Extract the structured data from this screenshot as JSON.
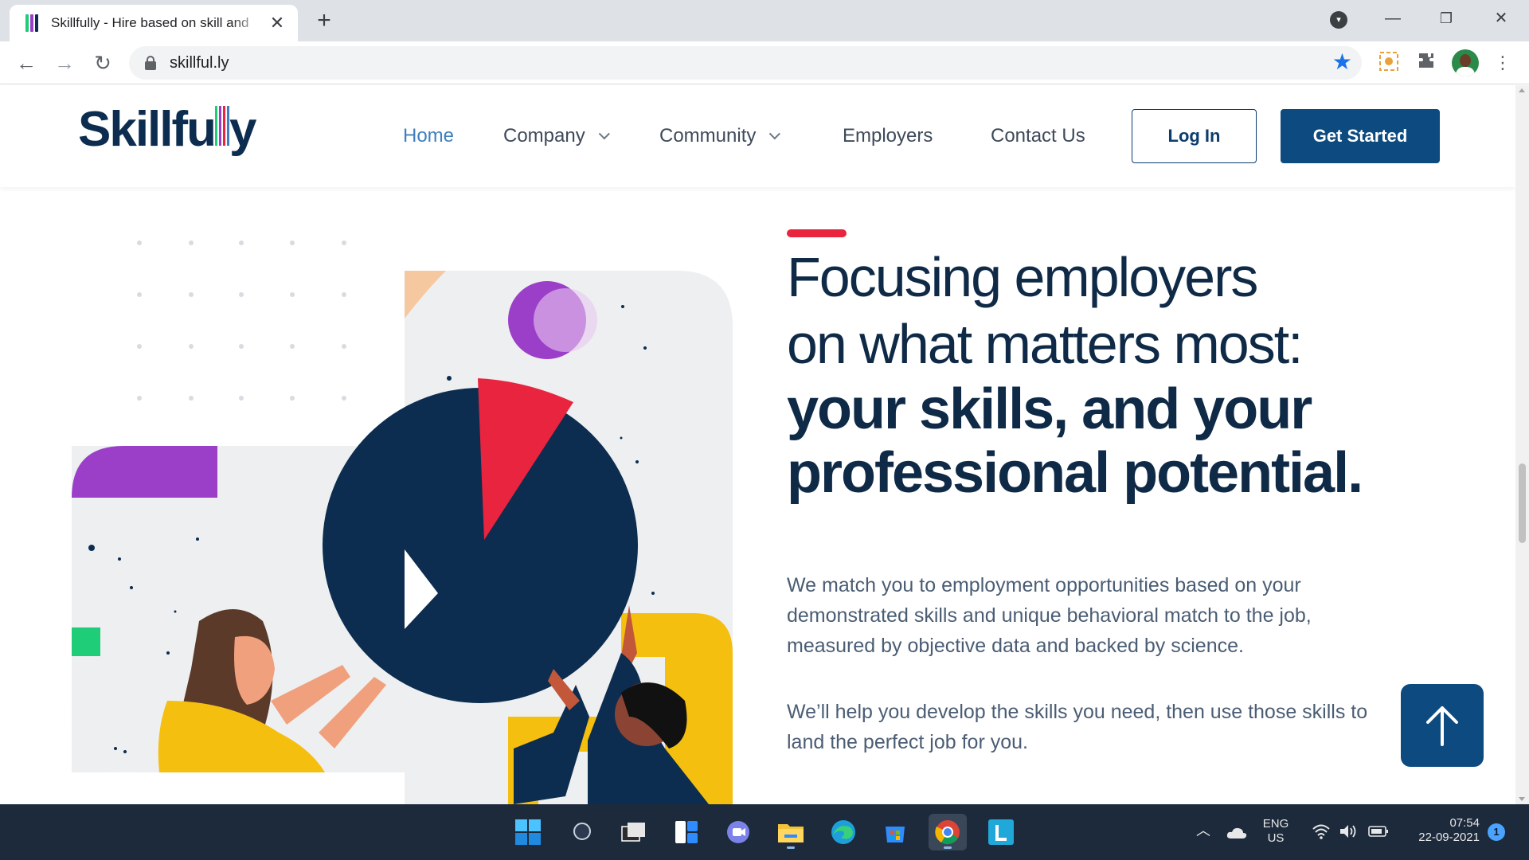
{
  "browser": {
    "tab_title": "Skillfully - Hire based on skill and",
    "url": "skillful.ly",
    "new_tab_label": "+",
    "close_tab_label": "✕"
  },
  "site": {
    "logo_text_a": "Skillfu",
    "logo_text_b": "y",
    "nav": {
      "home": "Home",
      "company": "Company",
      "community": "Community",
      "employers": "Employers",
      "contact": "Contact Us"
    },
    "login_label": "Log In",
    "get_started_label": "Get Started"
  },
  "hero": {
    "headline_line1": "Focusing employers",
    "headline_line2": "on what matters most:",
    "headline_line3": "your skills, and your",
    "headline_line4": "professional potential.",
    "para1": "We match you to employment opportunities based on your demonstrated skills and unique behavioral match to the job, measured by objective data and backed by science.",
    "para2": "We’ll help you develop the skills you need, then use those skills to land the perfect job for you."
  },
  "taskbar": {
    "lang_line1": "ENG",
    "lang_line2": "US",
    "time": "07:54",
    "date": "22-09-2021",
    "notification_count": "1"
  },
  "colors": {
    "brand_navy": "#0c2d4f",
    "button_blue": "#0c4a80",
    "accent_red": "#e8243f",
    "purple": "#9b3fc9",
    "yellow": "#f5bf0f",
    "green": "#1fcc77"
  }
}
